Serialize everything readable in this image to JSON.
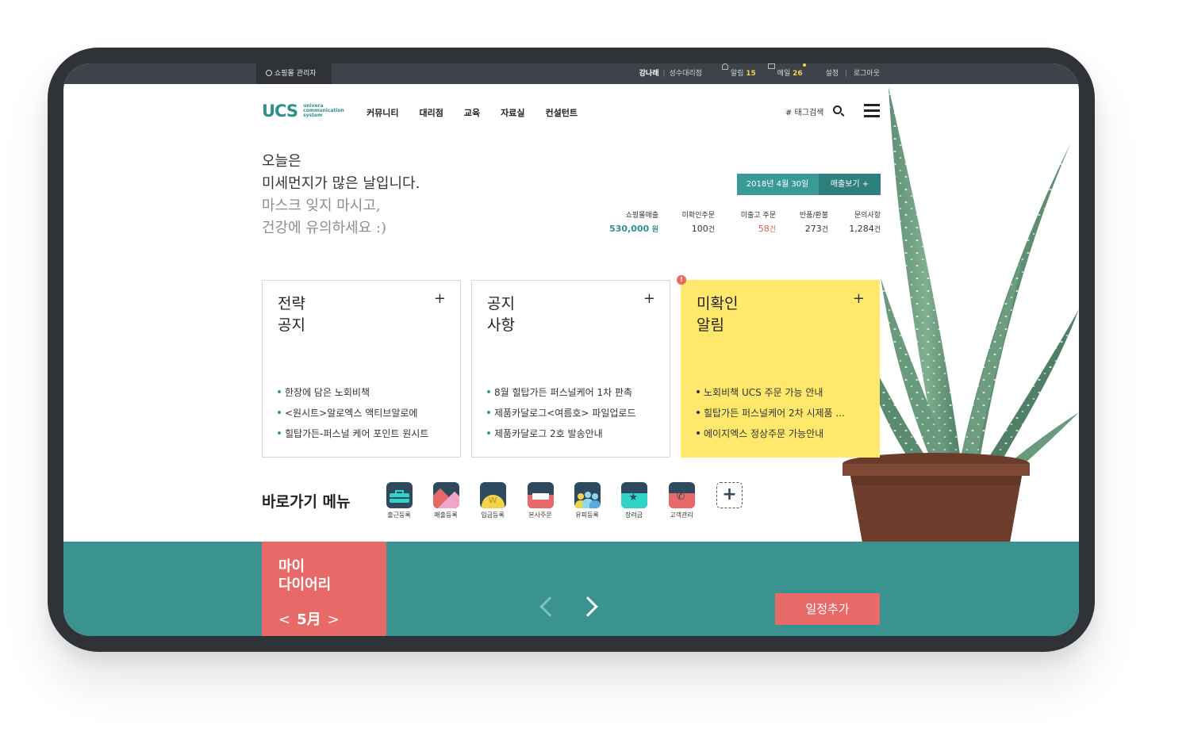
{
  "topbar": {
    "admin_label": "쇼핑몰 관리자",
    "user_name": "강나래",
    "store_name": "성수대리점",
    "alarm_label": "알림",
    "alarm_count": "15",
    "mail_label": "메일",
    "mail_count": "26",
    "settings_label": "설정",
    "logout_label": "로그아웃"
  },
  "nav": {
    "logo_main": "UCS",
    "logo_sub_1": "univera",
    "logo_sub_2": "communication",
    "logo_sub_3": "system",
    "items": [
      "커뮤니티",
      "대리점",
      "교육",
      "자료실",
      "컨설턴트"
    ],
    "tag_search": "# 태그검색"
  },
  "greeting": {
    "line1": "오늘은",
    "line2": "미세먼지가 많은 날입니다.",
    "line3": "마스크 잊지 마시고,",
    "line4": "건강에 유의하세요 :)"
  },
  "sales": {
    "date": "2018년 4월 30일",
    "view_button": "매출보기 +",
    "stats": [
      {
        "label": "쇼핑몰매출",
        "value": "530,000",
        "unit": "원"
      },
      {
        "label": "미확인주문",
        "value": "100",
        "unit": "건"
      },
      {
        "label": "미출고 주문",
        "value": "58",
        "unit": "건"
      },
      {
        "label": "반품/환불",
        "value": "273",
        "unit": "건"
      },
      {
        "label": "문의사항",
        "value": "1,284",
        "unit": "건"
      }
    ]
  },
  "cards": [
    {
      "title1": "전략",
      "title2": "공지",
      "items": [
        "한장에 담은 노회비책",
        "<원시트>알로엑스 액티브알로에",
        "힐탑가든-퍼스널 케어 포인트 원시트"
      ]
    },
    {
      "title1": "공지",
      "title2": "사항",
      "items": [
        "8월 힐탑가든 퍼스널케어 1차 판촉",
        "제품카달로그<여름호> 파일업로드",
        "제품카달로그 2호 발송안내"
      ]
    },
    {
      "title1": "미확인",
      "title2": "알림",
      "badge": "!",
      "items": [
        "노회비책 UCS 주문 가능 안내",
        "힐탑가든 퍼스널케어 2차 시제품 ...",
        "에이지엑스 정상주문 가능안내"
      ]
    }
  ],
  "quick_menu": {
    "title": "바로가기 메뉴",
    "items": [
      {
        "label": "출근등록",
        "icon": "briefcase-icon"
      },
      {
        "label": "매출등록",
        "icon": "chart-icon"
      },
      {
        "label": "입금등록",
        "icon": "coin-icon"
      },
      {
        "label": "본사주문",
        "icon": "monitor-icon"
      },
      {
        "label": "유피등록",
        "icon": "people-icon"
      },
      {
        "label": "장려금",
        "icon": "star-icon"
      },
      {
        "label": "고객관리",
        "icon": "phone-icon"
      }
    ],
    "add": "+"
  },
  "diary": {
    "title1": "마이",
    "title2": "다이어리",
    "month": "5月",
    "prev": "<",
    "next": ">"
  },
  "schedule": {
    "add_button": "일정추가"
  },
  "colors": {
    "teal": "#3b9390",
    "coral": "#e86a68",
    "yellow": "#ffe86b",
    "navy": "#2f4a5f"
  }
}
